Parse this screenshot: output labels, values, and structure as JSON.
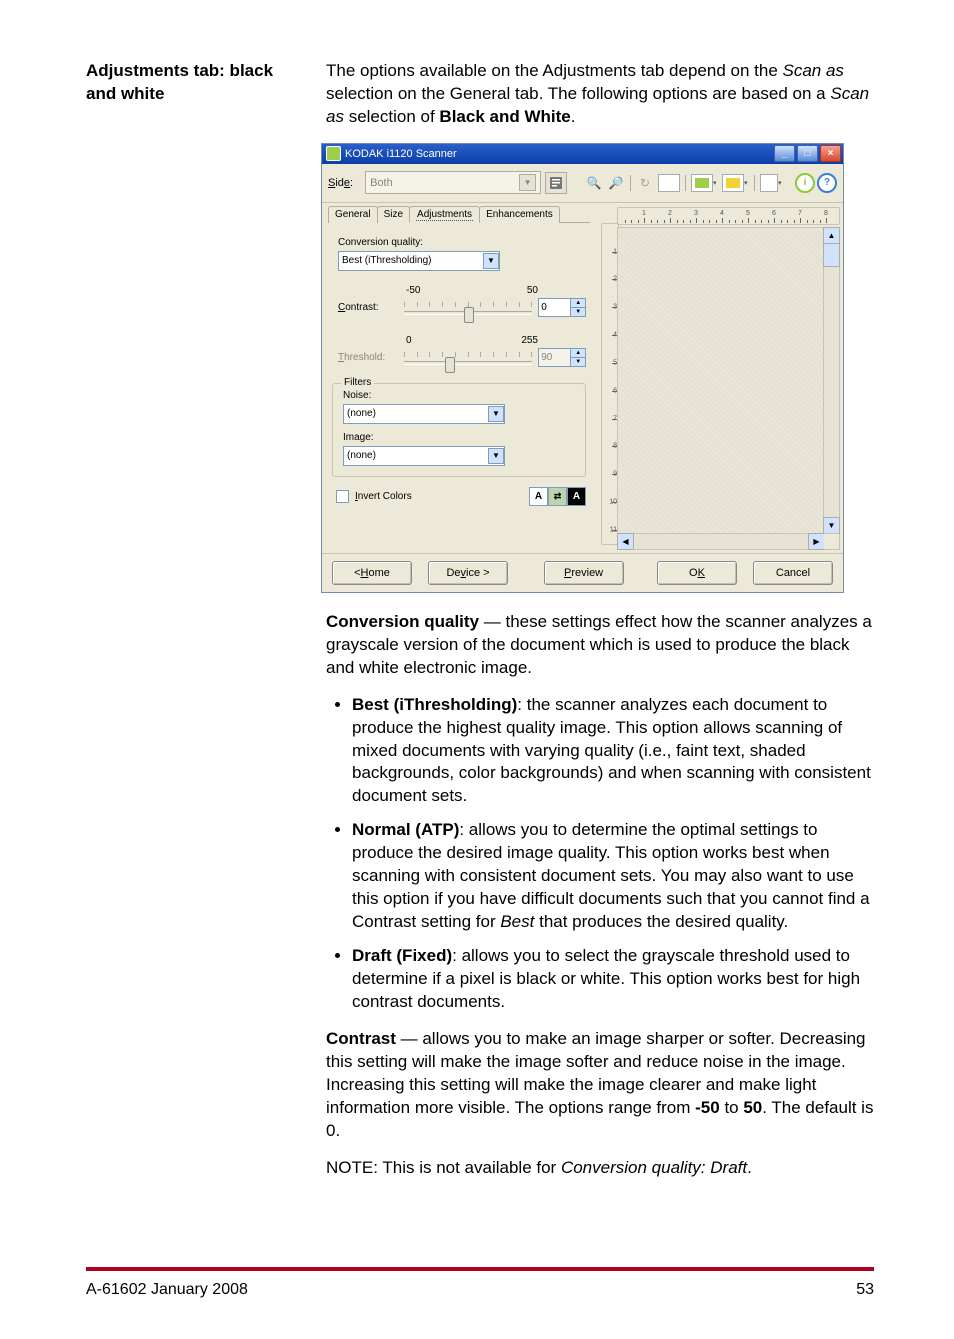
{
  "heading": "Adjustments tab: black and white",
  "intro": {
    "pre": "The options available on the Adjustments tab depend on the ",
    "scan_as": "Scan as",
    "mid": " selection on the General tab. The following options are based on a ",
    "scan_as2": "Scan as",
    "post": " selection of ",
    "bw": "Black and White",
    "end": "."
  },
  "win": {
    "title": "KODAK i1120 Scanner",
    "side_label": "Side:",
    "side_value": "Both",
    "tabs": [
      "General",
      "Size",
      "Adjustments",
      "Enhancements"
    ],
    "conv_q_label": "Conversion quality:",
    "conv_q_value": "Best (iThresholding)",
    "contrast_label": "Contrast:",
    "contrast_min": "-50",
    "contrast_max": "50",
    "contrast_value": "0",
    "threshold_label": "Threshold:",
    "threshold_min": "0",
    "threshold_max": "255",
    "threshold_value": "90",
    "filters_legend": "Filters",
    "noise_label": "Noise:",
    "noise_value": "(none)",
    "image_label": "Image:",
    "image_value": "(none)",
    "invert_label": "Invert Colors",
    "ruler": [
      "1",
      "2",
      "3",
      "4",
      "5",
      "6",
      "7",
      "8"
    ],
    "ruler_v": [
      "1",
      "2",
      "3",
      "4",
      "5",
      "6",
      "7",
      "8",
      "9",
      "10",
      "11"
    ],
    "btn_home": "< Home",
    "btn_device": "Device >",
    "btn_preview": "Preview",
    "btn_ok": "OK",
    "btn_cancel": "Cancel"
  },
  "para_convq": {
    "head": "Conversion quality",
    "body": " — these settings effect how the scanner analyzes a grayscale version of the document which is used to produce the black and white electronic image."
  },
  "bullets": [
    {
      "head": "Best (iThresholding)",
      "body": ": the scanner analyzes each document to produce the highest quality image. This option allows scanning of mixed documents with varying quality (i.e., faint text, shaded backgrounds, color backgrounds) and when scanning with consistent document sets."
    },
    {
      "head": "Normal (ATP)",
      "body": ": allows you to determine the optimal settings to produce the desired image quality. This option works best when scanning with consistent document sets. You may also want to use this option if you have difficult documents such that you cannot find a Contrast setting for ",
      "em": "Best",
      "tail": " that produces the desired quality."
    },
    {
      "head": "Draft (Fixed)",
      "body": ": allows you to select the grayscale threshold used to determine if a pixel is black or white. This option works best for high contrast documents."
    }
  ],
  "para_contrast": {
    "head": "Contrast",
    "body1": " — allows you to make an image sharper or softer. Decreasing this setting will make the image softer and reduce noise in the image. Increasing this setting will make the image clearer and make light information more visible. The options range from ",
    "b1": "-50",
    "mid": " to ",
    "b2": "50",
    "body2": ". The default is 0."
  },
  "note": {
    "pre": "NOTE: This is not available for ",
    "em": "Conversion quality: Draft",
    "post": "."
  },
  "footer_left": "A-61602   January 2008",
  "footer_right": "53"
}
